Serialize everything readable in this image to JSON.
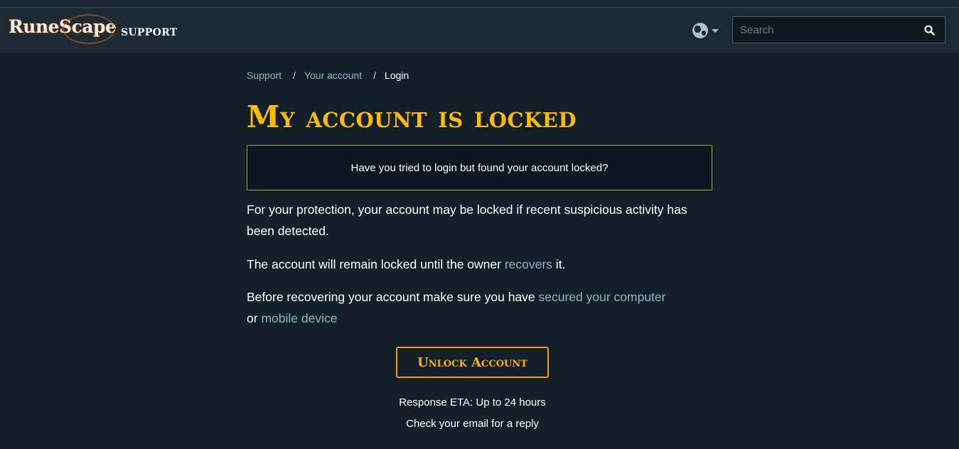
{
  "header": {
    "logo_text": "RuneScape",
    "section_label": "SUPPORT",
    "language_icon": "globe-icon",
    "search": {
      "placeholder": "Search",
      "value": "",
      "icon": "search-icon"
    }
  },
  "breadcrumb": {
    "items": [
      "Support",
      "Your account",
      "Login"
    ],
    "separator": "/"
  },
  "page": {
    "title": "My account is locked",
    "callout": "Have you tried to login but found your account locked?",
    "p1": "For your protection, your account may be locked if recent suspicious activity has been detected.",
    "p2_before": "The account will remain locked until the owner ",
    "p2_link": "recovers",
    "p2_after": " it.",
    "p3_before": "Before recovering your account make sure you have ",
    "p3_link1": "secured your computer",
    "p3_middle": " or ",
    "p3_link2": "mobile device",
    "button": "Unlock Account",
    "eta_line1": "Response ETA: Up to 24 hours",
    "eta_line2": "Check your email for a reply"
  },
  "colors": {
    "background": "#13202a",
    "header": "#1b2a35",
    "title": "#ffbb00",
    "link": "#8cb4cb",
    "button_border": "#f39a1c",
    "callout_border": "#b79a2c"
  }
}
